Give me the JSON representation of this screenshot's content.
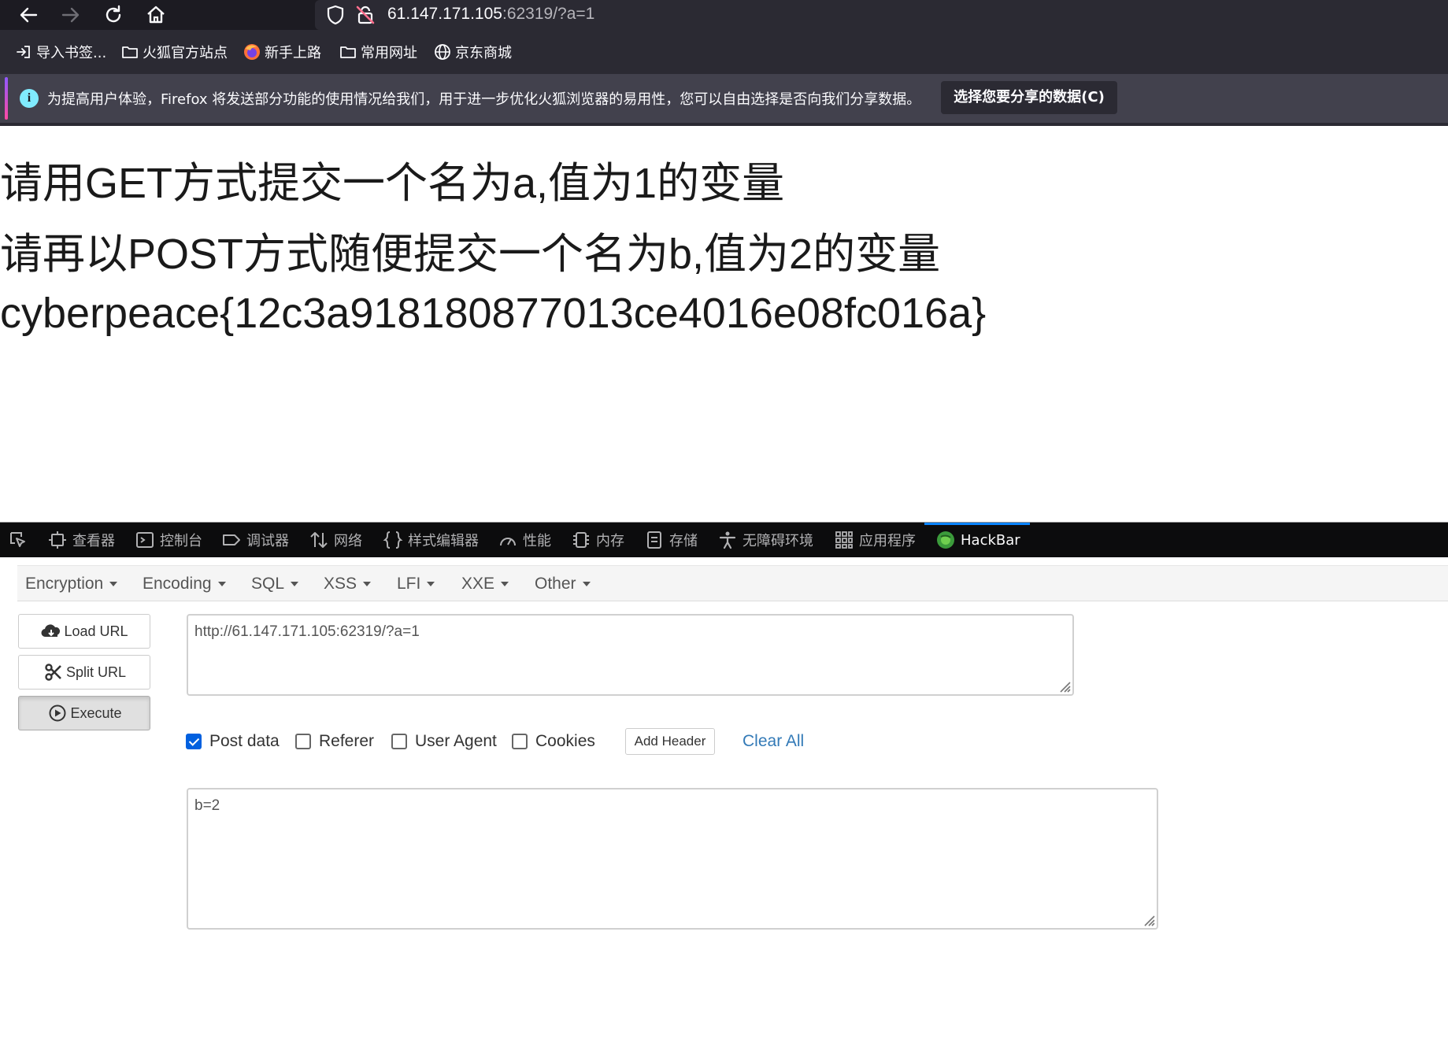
{
  "browser": {
    "url_host": "61.147.171.105",
    "url_rest": ":62319/?a=1",
    "bookmarks": [
      {
        "label": "导入书签...",
        "icon": "import-icon"
      },
      {
        "label": "火狐官方站点",
        "icon": "folder-icon"
      },
      {
        "label": "新手上路",
        "icon": "firefox-icon"
      },
      {
        "label": "常用网址",
        "icon": "folder-icon"
      },
      {
        "label": "京东商城",
        "icon": "globe-icon"
      }
    ],
    "notice": {
      "message": "为提高用户体验，Firefox 将发送部分功能的使用情况给我们，用于进一步优化火狐浏览器的易用性，您可以自由选择是否向我们分享数据。",
      "button": "选择您要分享的数据(C)"
    }
  },
  "page": {
    "lines": [
      "请用GET方式提交一个名为a,值为1的变量",
      "请再以POST方式随便提交一个名为b,值为2的变量",
      "cyberpeace{12c3a918180877013ce4016e08fc016a}"
    ]
  },
  "devtools": {
    "tabs": [
      {
        "label": "查看器",
        "icon": "inspector-icon"
      },
      {
        "label": "控制台",
        "icon": "console-icon"
      },
      {
        "label": "调试器",
        "icon": "debugger-icon"
      },
      {
        "label": "网络",
        "icon": "network-icon"
      },
      {
        "label": "样式编辑器",
        "icon": "style-editor-icon"
      },
      {
        "label": "性能",
        "icon": "performance-icon"
      },
      {
        "label": "内存",
        "icon": "memory-icon"
      },
      {
        "label": "存储",
        "icon": "storage-icon"
      },
      {
        "label": "无障碍环境",
        "icon": "accessibility-icon"
      },
      {
        "label": "应用程序",
        "icon": "application-icon"
      },
      {
        "label": "HackBar",
        "icon": "hackbar-icon",
        "active": true
      }
    ]
  },
  "hackbar": {
    "menu": [
      "Encryption",
      "Encoding",
      "SQL",
      "XSS",
      "LFI",
      "XXE",
      "Other"
    ],
    "buttons": {
      "load_url": "Load URL",
      "split_url": "Split URL",
      "execute": "Execute"
    },
    "url_value": "http://61.147.171.105:62319/?a=1",
    "options": {
      "post_data": {
        "label": "Post data",
        "checked": true
      },
      "referer": {
        "label": "Referer",
        "checked": false
      },
      "user_agent": {
        "label": "User Agent",
        "checked": false
      },
      "cookies": {
        "label": "Cookies",
        "checked": false
      }
    },
    "add_header": "Add Header",
    "clear_all": "Clear All",
    "post_value": "b=2"
  },
  "colors": {
    "chrome_bg": "#1c1b22",
    "notice_bg": "#42414d",
    "devtools_tabs_bg": "#0c0c0d",
    "active_tab_accent": "#0a84ff",
    "checkbox_checked": "#0060df",
    "link": "#337ab7"
  }
}
